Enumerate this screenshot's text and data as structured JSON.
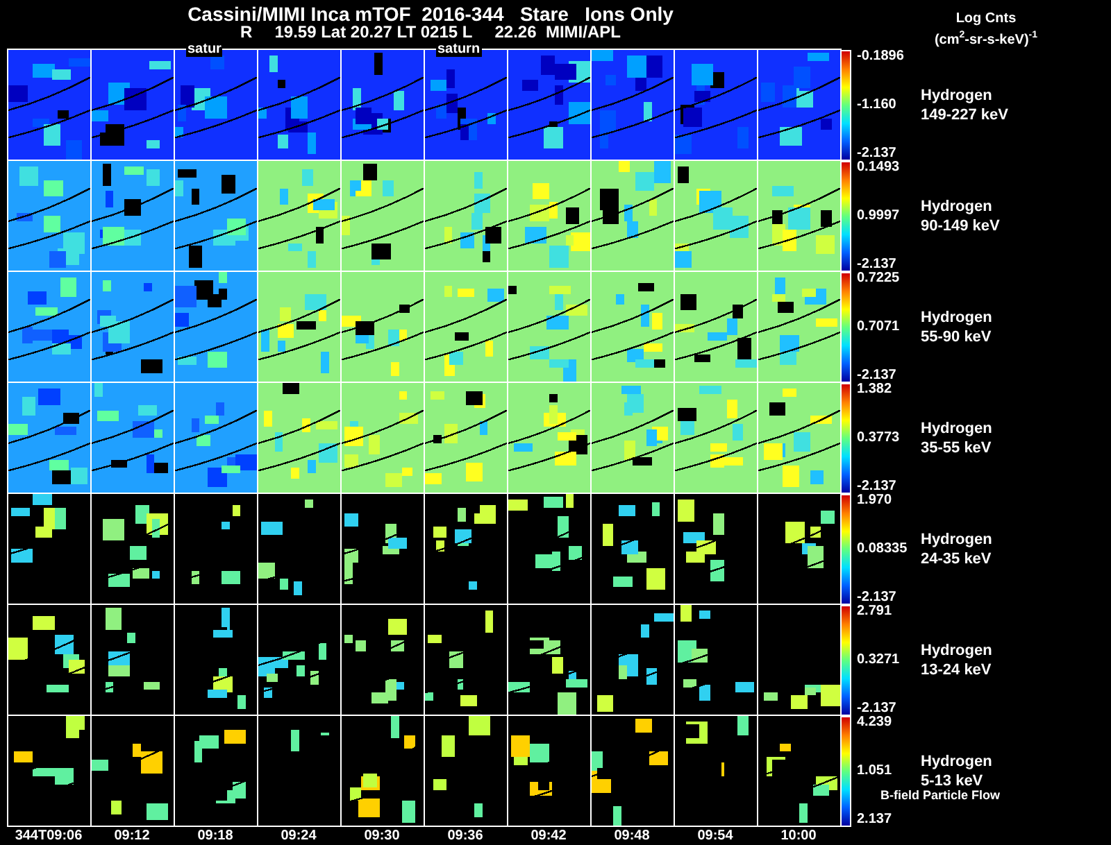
{
  "title": "Cassini/MIMI Inca mTOF  2016-344   Stare   Ions Only",
  "subtitle": [
    "R",
    "19.59 Lat 20.27 LT 0215 L",
    "22.26  MIMI/APL"
  ],
  "units": {
    "line_1": "Log Cnts",
    "line_2": "(cm$^{2}$-sr-s-keV)$^{-1}$"
  },
  "columns": [
    {
      "time": "344T09:06"
    },
    {
      "time": "09:12"
    },
    {
      "time": "09:18",
      "overlay_label": "satur"
    },
    {
      "time": "09:24"
    },
    {
      "time": "09:30"
    },
    {
      "time": "09:36",
      "overlay_label": "saturn"
    },
    {
      "time": "09:42"
    },
    {
      "time": "09:48"
    },
    {
      "time": "09:54"
    },
    {
      "time": "10:00"
    }
  ],
  "rows": [
    {
      "species": "Hydrogen",
      "energy": "149-227 keV",
      "scale_max": "-0.1896",
      "scale_mid": "-1.160",
      "scale_min": "-2.137"
    },
    {
      "species": "Hydrogen",
      "energy": "90-149 keV",
      "scale_max": "0.1493",
      "scale_mid": "0.9997",
      "scale_min": "-2.137"
    },
    {
      "species": "Hydrogen",
      "energy": "55-90 keV",
      "scale_max": "0.7225",
      "scale_mid": "0.7071",
      "scale_min": "-2.137"
    },
    {
      "species": "Hydrogen",
      "energy": "35-55 keV",
      "scale_max": "1.382",
      "scale_mid": "0.3773",
      "scale_min": "-2.137"
    },
    {
      "species": "Hydrogen",
      "energy": "24-35 keV",
      "scale_max": "1.970",
      "scale_mid": "0.08335",
      "scale_min": "-2.137"
    },
    {
      "species": "Hydrogen",
      "energy": "13-24 keV",
      "scale_max": "2.791",
      "scale_mid": "0.3271",
      "scale_min": "-2.137"
    },
    {
      "species": "Hydrogen",
      "energy": "5-13 keV",
      "scale_max": "4.239",
      "scale_mid": "1.051",
      "scale_min": "2.137"
    }
  ],
  "footer_note": "B-field Particle Flow"
}
